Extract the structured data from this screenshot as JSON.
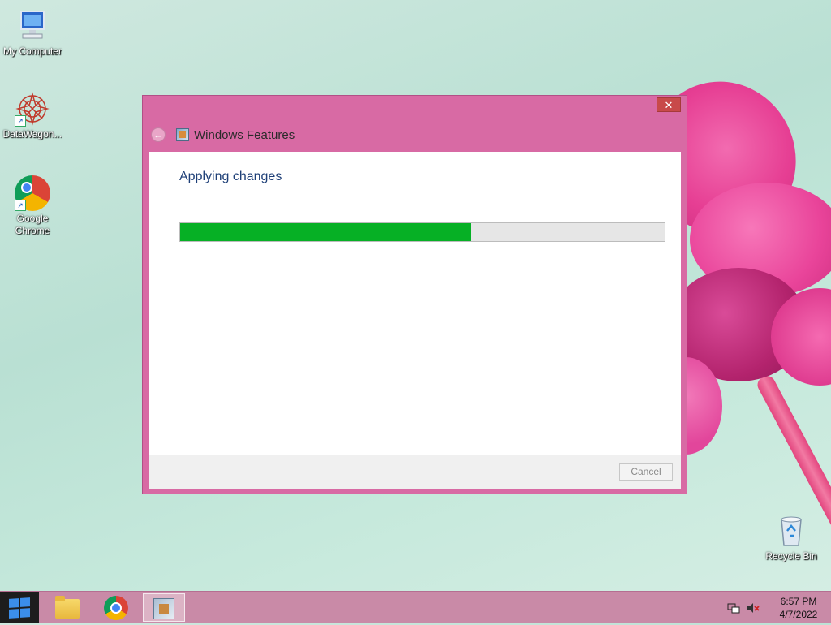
{
  "desktop": {
    "icons": [
      {
        "label": "My Computer"
      },
      {
        "label": "DataWagon..."
      },
      {
        "label": "Google Chrome"
      },
      {
        "label": "Recycle Bin"
      }
    ]
  },
  "window": {
    "title": "Windows Features",
    "close_glyph": "✕",
    "back_glyph": "←",
    "heading": "Applying changes",
    "progress_fraction": 0.6,
    "cancel_label": "Cancel"
  },
  "taskbar": {
    "apps": [
      "file-explorer",
      "google-chrome",
      "windows-features"
    ],
    "clock": {
      "time": "6:57 PM",
      "date": "4/7/2022"
    },
    "tray_icons": [
      "network-icon",
      "speaker-muted-icon"
    ]
  },
  "colors": {
    "window_frame": "#d86aa4",
    "progress_fill": "#06b025",
    "close_button": "#c84a4a"
  }
}
